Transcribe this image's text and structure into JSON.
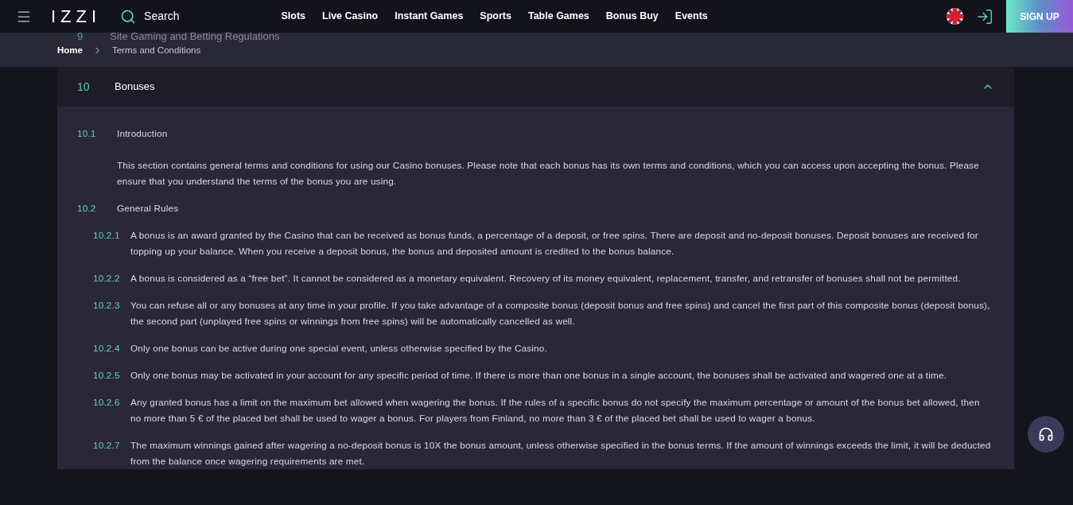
{
  "header": {
    "logo": "IZZI",
    "search": "Search",
    "nav": [
      "Slots",
      "Live Casino",
      "Instant Games",
      "Sports",
      "Table Games",
      "Bonus Buy",
      "Events"
    ],
    "signup": "SIGN UP"
  },
  "faded_row": {
    "number": "9",
    "title": "Site Gaming and Betting Regulations"
  },
  "breadcrumb": [
    "Home",
    "Terms and Conditions"
  ],
  "section": {
    "number": "10",
    "title": "Bonuses",
    "expanded": true,
    "subsections": [
      {
        "number": "10.1",
        "title": "Introduction",
        "text": "This section contains general terms and conditions for using our Casino bonuses. Please note that each bonus has its own terms and conditions, which you can access upon accepting the bonus. Please ensure that you understand the terms of the bonus you are using."
      },
      {
        "number": "10.2",
        "title": "General Rules",
        "rules": [
          {
            "number": "10.2.1",
            "text": "A bonus is an award granted by the Casino that can be received as bonus funds, a percentage of a deposit, or free spins. There are deposit and no-deposit bonuses. Deposit bonuses are received for topping up your balance. When you receive a deposit bonus, the bonus and deposited amount is credited to the bonus balance."
          },
          {
            "number": "10.2.2",
            "text": "A bonus is considered as a “free bet”. It cannot be considered as a monetary equivalent. Recovery of its money equivalent, replacement, transfer, and retransfer of bonuses shall not be permitted."
          },
          {
            "number": "10.2.3",
            "text": "You can refuse all or any bonuses at any time in your profile. If you take advantage of a composite bonus (deposit bonus and free spins) and cancel the first part of this composite bonus (deposit bonus), the second part (unplayed free spins or winnings from free spins) will be automatically cancelled as well."
          },
          {
            "number": "10.2.4",
            "text": "Only one bonus can be active during one special event, unless otherwise specified by the Casino."
          },
          {
            "number": "10.2.5",
            "text": "Only one bonus may be activated in your account for any specific period of time. If there is more than one bonus in a single account, the bonuses shall be activated and wagered one at a time."
          },
          {
            "number": "10.2.6",
            "text": "Any granted bonus has a limit on the maximum bet allowed when wagering the bonus. If the rules of a specific bonus do not specify the maximum percentage or amount of the bonus bet allowed, then no more than 5 € of the placed bet shall be used to wager a bonus. For players from Finland, no more than 3 € of the placed bet shall be used to wager a bonus."
          },
          {
            "number": "10.2.7",
            "text": "The maximum winnings gained after wagering a no-deposit bonus is 10X the bonus amount, unless otherwise specified in the bonus terms. If the amount of winnings exceeds the limit, it will be deducted from the balance once wagering requirements are met."
          }
        ]
      }
    ]
  }
}
